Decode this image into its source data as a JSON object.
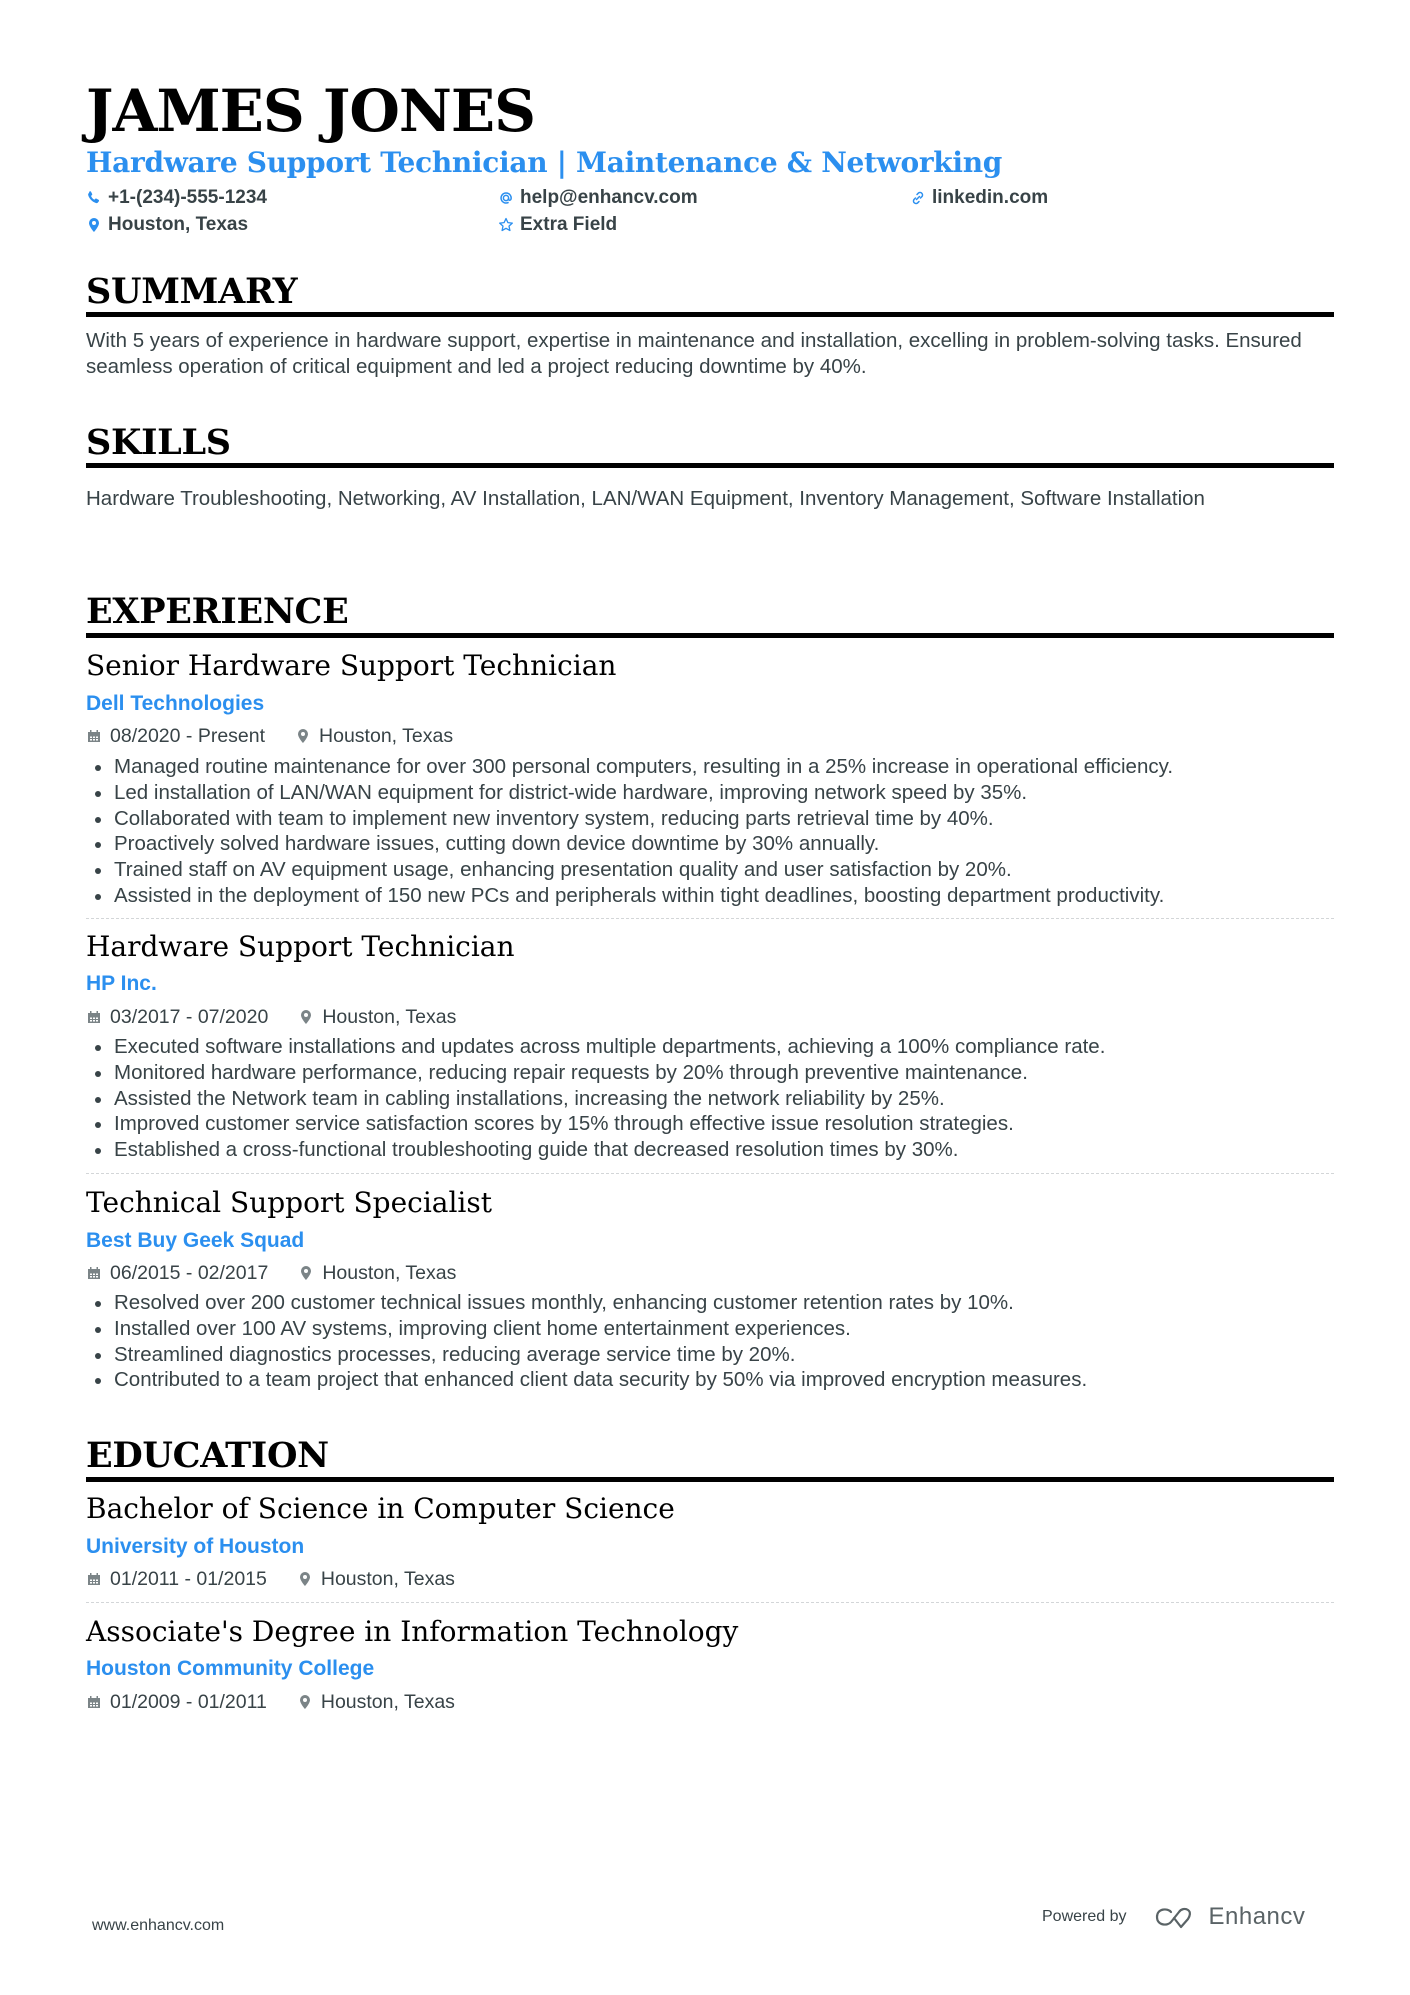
{
  "header": {
    "name": "JAMES JONES",
    "title": "Hardware Support Technician | Maintenance & Networking",
    "contacts": {
      "phone": {
        "icon": "phone-icon",
        "value": "+1-(234)-555-1234"
      },
      "email": {
        "icon": "at-icon",
        "value": "help@enhancv.com"
      },
      "linkedin": {
        "icon": "link-icon",
        "value": "linkedin.com"
      },
      "location": {
        "icon": "map-pin-icon",
        "value": "Houston, Texas"
      },
      "extra": {
        "icon": "star-icon",
        "value": "Extra Field"
      }
    }
  },
  "summary": {
    "heading": "SUMMARY",
    "text": "With 5 years of experience in hardware support, expertise in maintenance and installation, excelling in problem-solving tasks. Ensured seamless operation of critical equipment and led a project reducing downtime by 40%."
  },
  "skills": {
    "heading": "SKILLS",
    "text": "Hardware Troubleshooting, Networking, AV Installation, LAN/WAN Equipment, Inventory Management, Software Installation"
  },
  "experience": {
    "heading": "EXPERIENCE",
    "jobs": [
      {
        "title": "Senior Hardware Support Technician",
        "company": "Dell Technologies",
        "dates": "08/2020 - Present",
        "location": "Houston, Texas",
        "bullets": [
          "Managed routine maintenance for over 300 personal computers, resulting in a 25% increase in operational efficiency.",
          "Led installation of LAN/WAN equipment for district-wide hardware, improving network speed by 35%.",
          "Collaborated with team to implement new inventory system, reducing parts retrieval time by 40%.",
          "Proactively solved hardware issues, cutting down device downtime by 30% annually.",
          "Trained staff on AV equipment usage, enhancing presentation quality and user satisfaction by 20%.",
          "Assisted in the deployment of 150 new PCs and peripherals within tight deadlines, boosting department productivity."
        ]
      },
      {
        "title": "Hardware Support Technician",
        "company": "HP Inc.",
        "dates": "03/2017 - 07/2020",
        "location": "Houston, Texas",
        "bullets": [
          "Executed software installations and updates across multiple departments, achieving a 100% compliance rate.",
          "Monitored hardware performance, reducing repair requests by 20% through preventive maintenance.",
          "Assisted the Network team in cabling installations, increasing the network reliability by 25%.",
          "Improved customer service satisfaction scores by 15% through effective issue resolution strategies.",
          "Established a cross-functional troubleshooting guide that decreased resolution times by 30%."
        ]
      },
      {
        "title": "Technical Support Specialist",
        "company": "Best Buy Geek Squad",
        "dates": "06/2015 - 02/2017",
        "location": "Houston, Texas",
        "bullets": [
          "Resolved over 200 customer technical issues monthly, enhancing customer retention rates by 10%.",
          "Installed over 100 AV systems, improving client home entertainment experiences.",
          "Streamlined diagnostics processes, reducing average service time by 20%.",
          "Contributed to a team project that enhanced client data security by 50% via improved encryption measures."
        ]
      }
    ]
  },
  "education": {
    "heading": "EDUCATION",
    "entries": [
      {
        "degree": "Bachelor of Science in Computer Science",
        "school": "University of Houston",
        "dates": "01/2011 - 01/2015",
        "location": "Houston, Texas"
      },
      {
        "degree": "Associate's Degree in Information Technology",
        "school": "Houston Community College",
        "dates": "01/2009 - 01/2011",
        "location": "Houston, Texas"
      }
    ]
  },
  "footer": {
    "website": "www.enhancv.com",
    "powered_by": "Powered by",
    "brand": "Enhancv"
  },
  "colors": {
    "accent": "#2b8fef",
    "text": "#384347",
    "heading": "#000000"
  }
}
